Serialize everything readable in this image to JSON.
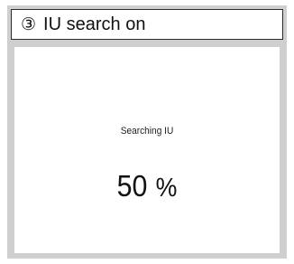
{
  "header": {
    "step_number": "③",
    "title": "IU search on"
  },
  "screen": {
    "status_text": "Searching IU",
    "progress_value": "50",
    "progress_unit": "%"
  }
}
